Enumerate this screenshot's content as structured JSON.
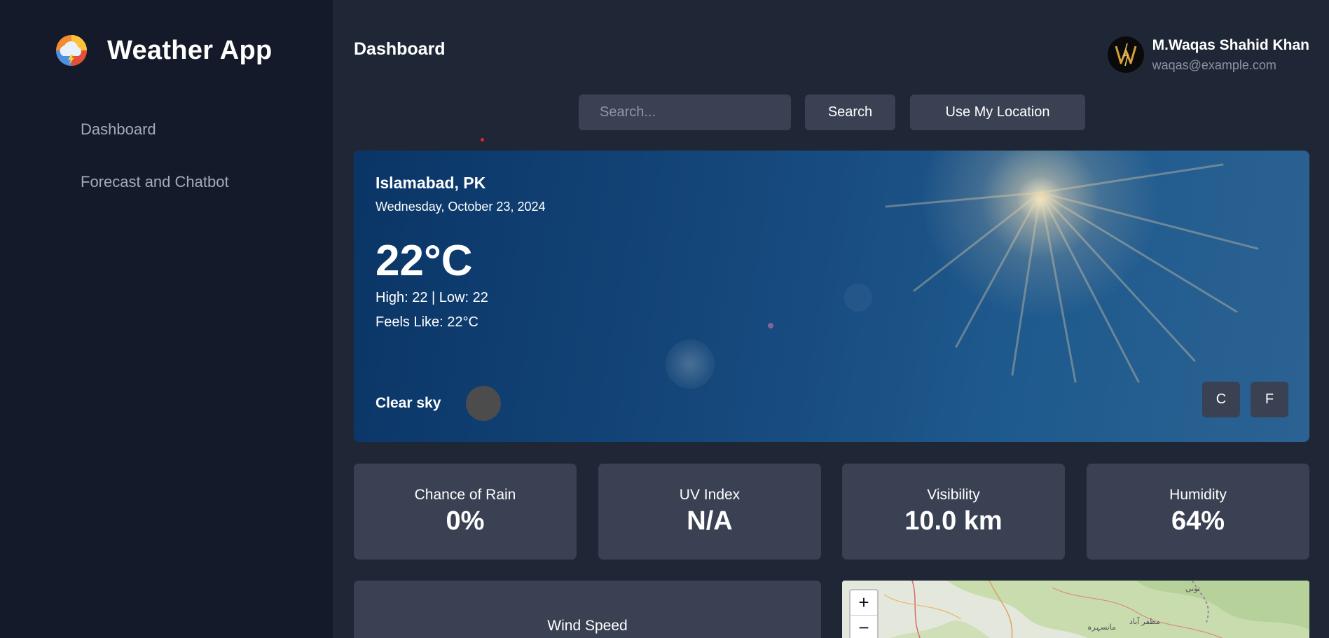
{
  "app": {
    "title": "Weather App"
  },
  "sidebar": {
    "items": [
      {
        "label": "Dashboard"
      },
      {
        "label": "Forecast and Chatbot"
      }
    ]
  },
  "header": {
    "title": "Dashboard",
    "user": {
      "name": "M.Waqas Shahid Khan",
      "email": "waqas@example.com"
    }
  },
  "search": {
    "placeholder": "Search...",
    "value": "",
    "search_label": "Search",
    "location_label": "Use My Location"
  },
  "current": {
    "city": "Islamabad, PK",
    "date": "Wednesday, October 23, 2024",
    "temperature": "22°C",
    "high_low": "High: 22 | Low: 22",
    "feels_like": "Feels Like: 22°C",
    "condition": "Clear sky",
    "units": [
      "C",
      "F"
    ]
  },
  "stats": [
    {
      "label": "Chance of Rain",
      "value": "0%"
    },
    {
      "label": "UV Index",
      "value": "N/A"
    },
    {
      "label": "Visibility",
      "value": "10.0 km"
    },
    {
      "label": "Humidity",
      "value": "64%"
    }
  ],
  "wind": {
    "label": "Wind Speed"
  },
  "map": {
    "zoom_in": "+",
    "zoom_out": "−",
    "labels": [
      "مانسہرہ",
      "مظفر آباد",
      "تونی"
    ]
  },
  "colors": {
    "sidebar_bg": "#141a29",
    "main_bg": "#1f2737",
    "card_bg": "#394152",
    "hero_bg": "#0a3566"
  },
  "icons": {
    "logo": "cloud-rain-lightning-sun-icon",
    "condition": "weather-condition-icon",
    "avatar": "w-monogram-avatar"
  }
}
